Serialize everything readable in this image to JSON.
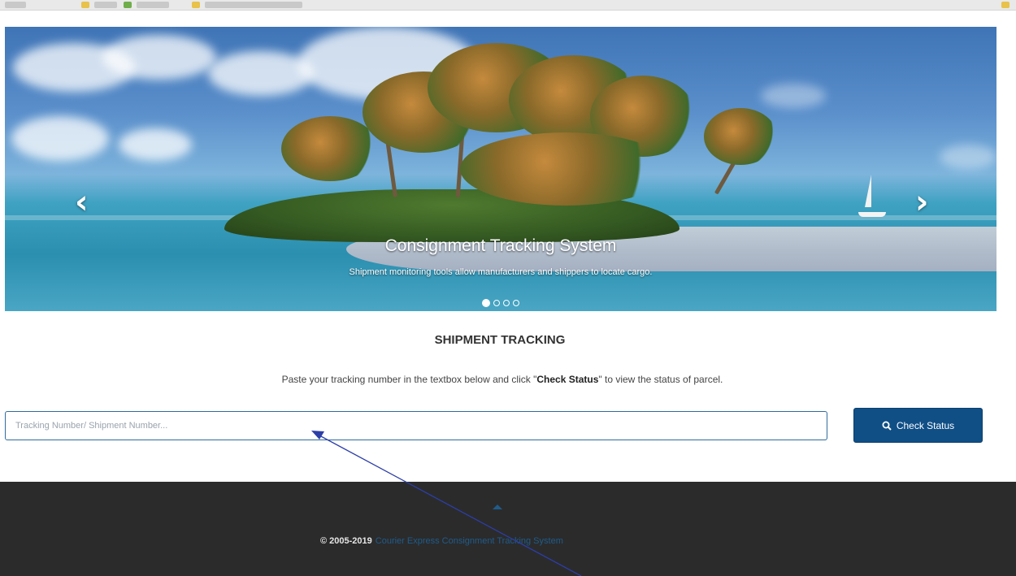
{
  "carousel": {
    "title": "Consignment Tracking System",
    "text": "Shipment monitoring tools allow manufacturers and shippers to locate cargo.",
    "prev_icon": "chevron-left-icon",
    "next_icon": "chevron-right-icon",
    "slide_count": 4,
    "active_slide": 1
  },
  "tracking": {
    "heading": "SHIPMENT TRACKING",
    "instruction_before": "Paste your tracking number in the textbox below and click \"",
    "instruction_bold": "Check Status",
    "instruction_after": "\" to view the status of parcel.",
    "input_placeholder": "Tracking Number/ Shipment Number...",
    "input_value": "",
    "button_label": "Check Status",
    "button_icon": "search-icon"
  },
  "footer": {
    "back_to_top_icon": "chevron-up-icon",
    "copyright": "© 2005-2019",
    "link_text": "Courier Express Consignment Tracking System"
  },
  "colors": {
    "primary_button": "#104f86",
    "footer_bg": "#2b2b2c",
    "link": "#1f5c8a",
    "annotation_arrow": "#2c3ea8"
  }
}
